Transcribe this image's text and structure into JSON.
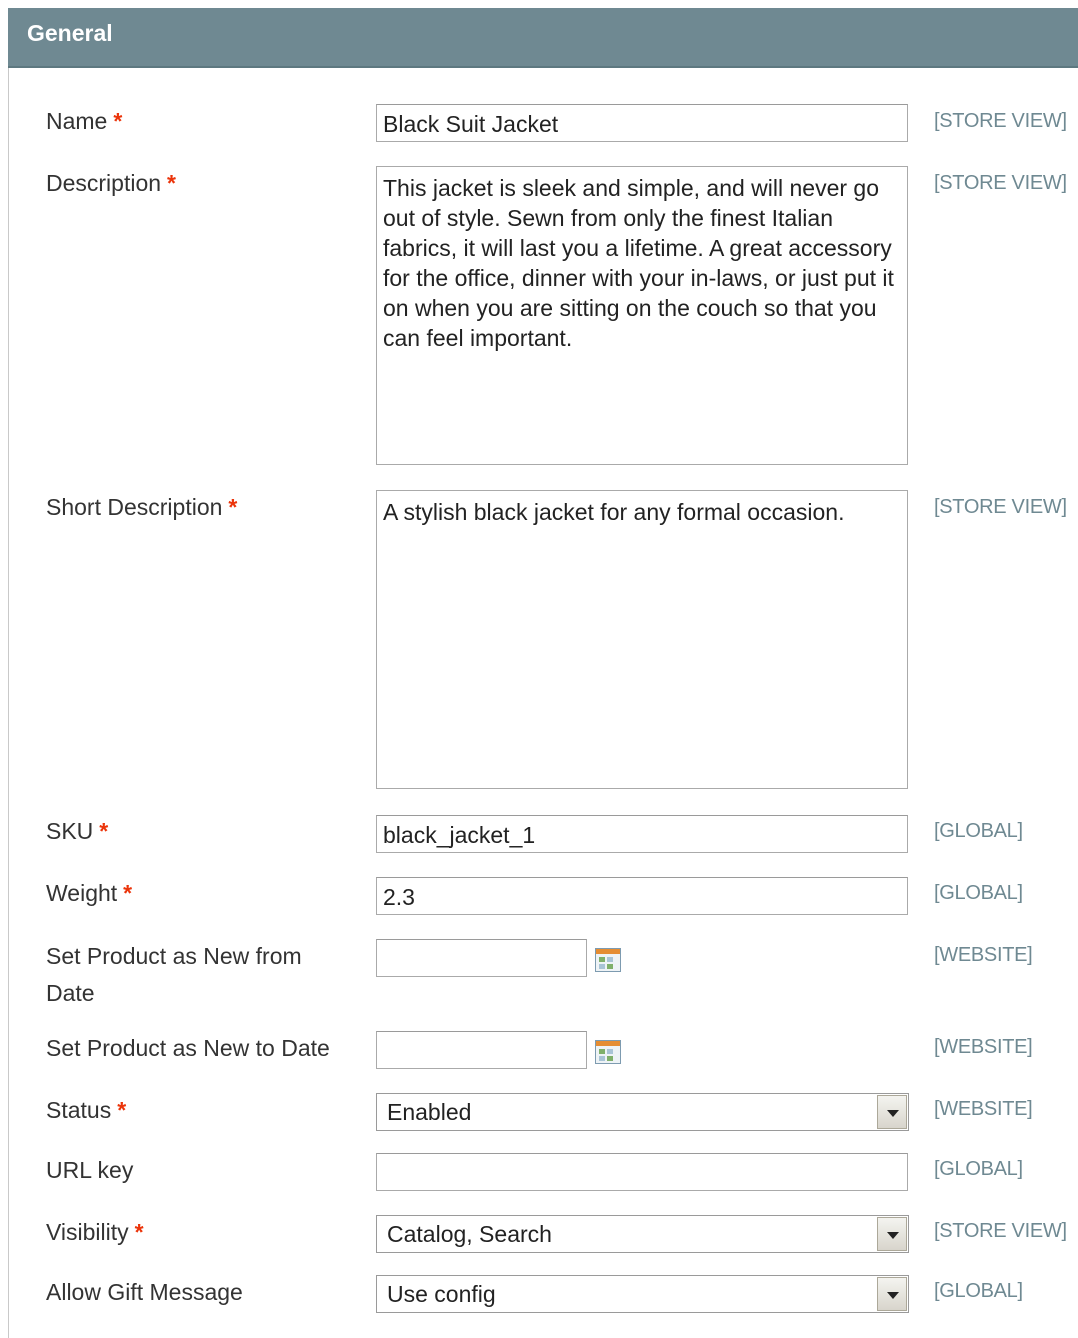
{
  "section": {
    "title": "General"
  },
  "required_mark": "*",
  "fields": {
    "name": {
      "label": "Name",
      "value": "Black Suit Jacket",
      "scope": "[STORE VIEW]"
    },
    "description": {
      "label": "Description",
      "value": "This jacket is sleek and simple, and will never go out of style. Sewn from only the finest Italian fabrics, it will last you a lifetime. A great accessory for the office, dinner with your in-laws, or just put it on when you are sitting on the couch so that you can feel important.",
      "scope": "[STORE VIEW]"
    },
    "short_description": {
      "label": "Short Description",
      "value": "A stylish black jacket for any formal occasion.",
      "scope": "[STORE VIEW]"
    },
    "sku": {
      "label": "SKU",
      "value": "black_jacket_1",
      "scope": "[GLOBAL]"
    },
    "weight": {
      "label": "Weight",
      "value": "2.3",
      "scope": "[GLOBAL]"
    },
    "new_from": {
      "label_line1": "Set Product as New from",
      "label_line2": "Date",
      "value": "",
      "scope": "[WEBSITE]",
      "icon": "calendar-icon"
    },
    "new_to": {
      "label": "Set Product as New to Date",
      "value": "",
      "scope": "[WEBSITE]",
      "icon": "calendar-icon"
    },
    "status": {
      "label": "Status",
      "value": "Enabled",
      "scope": "[WEBSITE]"
    },
    "url_key": {
      "label": "URL key",
      "value": "",
      "scope": "[GLOBAL]"
    },
    "visibility": {
      "label": "Visibility",
      "value": "Catalog, Search",
      "scope": "[STORE VIEW]"
    },
    "gift_message": {
      "label": "Allow Gift Message",
      "value": "Use config",
      "scope": "[GLOBAL]"
    }
  },
  "colors": {
    "header": "#6f8992",
    "required": "#eb340a",
    "scope_text": "#6f8992"
  }
}
